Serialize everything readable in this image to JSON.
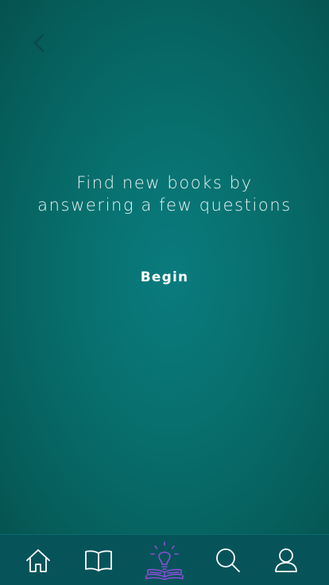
{
  "colors": {
    "background": "#08716f",
    "tabbar": "#06545a",
    "text": "#e8f4f4",
    "active_tab": "#8a4fd6",
    "inactive_tab": "#ffffff",
    "back_arrow": "#0b4a52"
  },
  "header": {
    "back_icon": "chevron-left-icon"
  },
  "main": {
    "headline_line1": "Find new books by",
    "headline_line2": "answering a few questions",
    "begin_label": "Begin"
  },
  "tabbar": {
    "active": "discover",
    "tabs": [
      {
        "id": "home",
        "icon": "home-icon"
      },
      {
        "id": "library",
        "icon": "open-book-icon"
      },
      {
        "id": "discover",
        "icon": "lightbulb-book-icon"
      },
      {
        "id": "search",
        "icon": "search-icon"
      },
      {
        "id": "profile",
        "icon": "user-icon"
      }
    ]
  }
}
